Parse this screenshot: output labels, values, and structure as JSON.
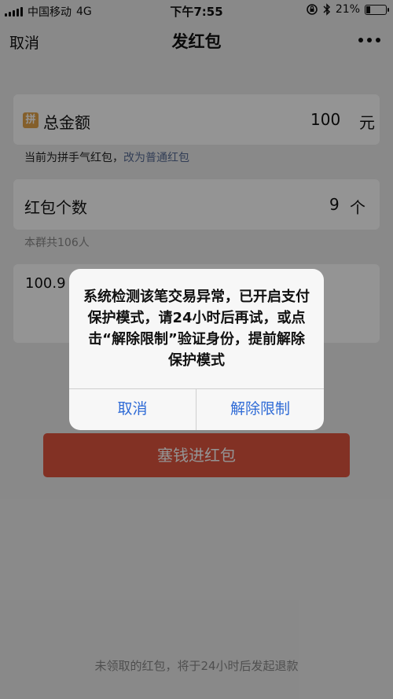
{
  "status": {
    "carrier": "中国移动",
    "network": "4G",
    "time": "下午7:55",
    "battery": "21%",
    "battery_fraction": 0.21
  },
  "nav": {
    "cancel": "取消",
    "title": "发红包"
  },
  "form": {
    "total_label": "总金额",
    "pin_icon_char": "拼",
    "total_value": "100",
    "total_unit": "元",
    "hint_prefix": "当前为拼手气红包，",
    "hint_link": "改为普通红包",
    "count_label": "红包个数",
    "count_value": "9",
    "count_unit": "个",
    "group_info": "本群共106人",
    "greeting": "100.9",
    "send_button": "塞钱进红包"
  },
  "footer_note": "未领取的红包，将于24小时后发起退款",
  "dialog": {
    "message": "系统检测该笔交易异常，已开启支付保护模式，请24小时后再试，或点击“解除限制”验证身份，提前解除保护模式",
    "cancel": "取消",
    "confirm": "解除限制"
  },
  "colors": {
    "accent": "#e0553e",
    "link": "#576b95",
    "dialog_button": "#2f6bd6"
  }
}
